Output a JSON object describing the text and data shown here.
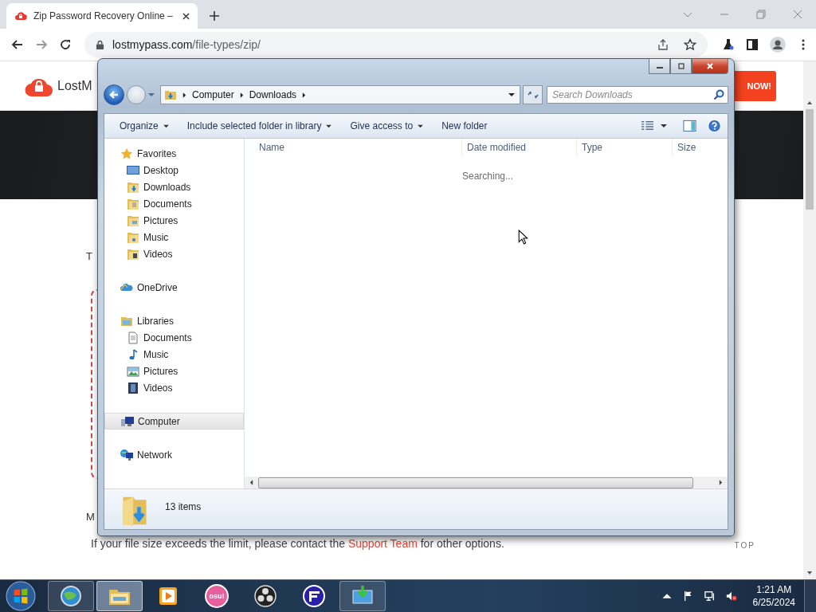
{
  "browser": {
    "tab": {
      "title": "Zip Password Recovery Online –"
    },
    "address": {
      "host": "lostmypass.com",
      "path": "/file-types/zip/"
    }
  },
  "page": {
    "logo": "LostM",
    "cta": "NOW!",
    "letters": [
      "T",
      "M"
    ],
    "notice": {
      "before": "If your file size exceeds the limit, please contact the ",
      "link": "Support Team",
      "after": " for other options."
    },
    "top_link": "TOP"
  },
  "dialog": {
    "breadcrumb": [
      "Computer",
      "Downloads"
    ],
    "search": {
      "placeholder": "Search Downloads"
    },
    "toolbar": [
      {
        "label": "Organize",
        "dropdown": true
      },
      {
        "label": "Include selected folder in library",
        "dropdown": true
      },
      {
        "label": "Give access to",
        "dropdown": true
      },
      {
        "label": "New folder",
        "dropdown": false
      }
    ],
    "nav": [
      {
        "label": "Favorites",
        "kind": "star",
        "selected": false,
        "children": [
          {
            "label": "Desktop",
            "kind": "desktop",
            "selected": false
          },
          {
            "label": "Downloads",
            "kind": "folder-download",
            "selected": false
          },
          {
            "label": "Documents",
            "kind": "folder-documents",
            "selected": false
          },
          {
            "label": "Pictures",
            "kind": "folder-pictures",
            "selected": false
          },
          {
            "label": "Music",
            "kind": "folder-music",
            "selected": false
          },
          {
            "label": "Videos",
            "kind": "folder-videos",
            "selected": false
          }
        ]
      },
      {
        "label": "OneDrive",
        "kind": "cloud",
        "selected": false
      },
      {
        "label": "Libraries",
        "kind": "library",
        "selected": false,
        "children": [
          {
            "label": "Documents",
            "kind": "documents",
            "selected": false
          },
          {
            "label": "Music",
            "kind": "music",
            "selected": false
          },
          {
            "label": "Pictures",
            "kind": "pictures",
            "selected": false
          },
          {
            "label": "Videos",
            "kind": "videos",
            "selected": false
          }
        ]
      },
      {
        "label": "Computer",
        "kind": "computer",
        "selected": true
      },
      {
        "label": "Network",
        "kind": "network",
        "selected": false
      }
    ],
    "columns": [
      "Name",
      "Date modified",
      "Type",
      "Size"
    ],
    "status_text": "Searching...",
    "item_count": "13 items"
  },
  "taskbar": {
    "apps": [
      {
        "kind": "globe",
        "running": true,
        "selected": false
      },
      {
        "kind": "explorer",
        "running": true,
        "selected": true
      },
      {
        "kind": "player",
        "running": false,
        "selected": false
      },
      {
        "kind": "osu",
        "running": false,
        "selected": false,
        "label": "osu!"
      },
      {
        "kind": "aperture",
        "running": false,
        "selected": false
      },
      {
        "kind": "striped",
        "running": false,
        "selected": false
      },
      {
        "kind": "monitor",
        "running": true,
        "selected": false
      }
    ],
    "time": "1:21 AM",
    "date": "6/25/2024"
  }
}
